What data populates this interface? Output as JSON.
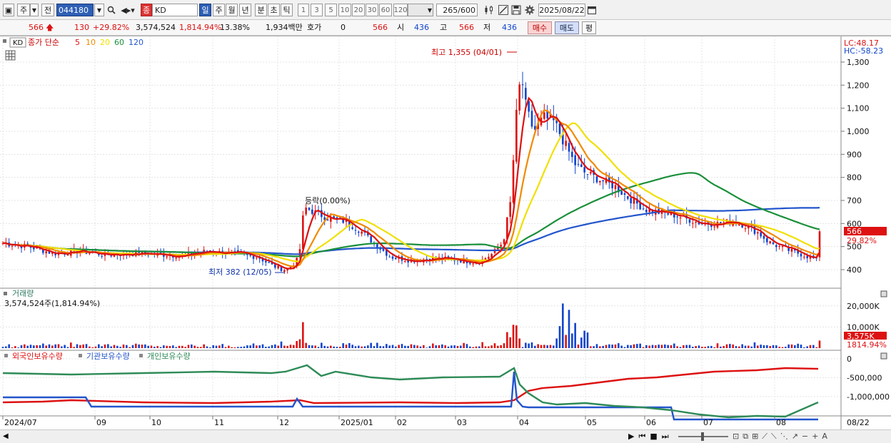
{
  "toolbar": {
    "market_label": "주",
    "prev_label": "전",
    "code": "044180",
    "name_badge": "종",
    "name": "KD",
    "periods": [
      "일",
      "주",
      "월",
      "년",
      "분",
      "초",
      "틱"
    ],
    "active_period": "일",
    "intervals": [
      "1",
      "3",
      "5",
      "10",
      "20",
      "30",
      "60",
      "120"
    ],
    "count": "265",
    "count_max": "/600",
    "date": "2025/08/22"
  },
  "quote": {
    "price": "566",
    "change": "130",
    "change_pct": "+29.82%",
    "volume": "3,574,524",
    "volume_pct": "1,814.94%",
    "turnover_pct": "13.38%",
    "amount": "1,934백만",
    "hoga_label": "호가",
    "hoga": "0",
    "hoga_price": "566",
    "open_label": "시",
    "open": "436",
    "high_label": "고",
    "high": "566",
    "low_label": "저",
    "low": "436",
    "buy_label": "매수",
    "sell_label": "매도",
    "eval_label": "평"
  },
  "chart": {
    "code_tag": "KD",
    "ma_title": "종가 단순",
    "ma_periods": [
      "5",
      "10",
      "20",
      "60",
      "120"
    ],
    "ma_colors": [
      "#dd1111",
      "#f08a00",
      "#f0e000",
      "#1a8f3a",
      "#2255cc"
    ],
    "lc_label": "LC:48.17",
    "hc_label": "HC:-58.23",
    "price_ticks": [
      "1,300",
      "1,200",
      "1,100",
      "1,000",
      "900",
      "800",
      "700",
      "600",
      "500",
      "400"
    ],
    "price_tick_values": [
      1300,
      1200,
      1100,
      1000,
      900,
      800,
      700,
      600,
      500,
      400
    ],
    "high_annot": "최고 1,355 (04/01)",
    "low_annot": "최저 382 (12/05)",
    "drop_annot": "등락(0.00%)",
    "last_price_tag": "566",
    "last_pct_tag": "29.82%",
    "volume_title": "거래량",
    "volume_value": "3,574,524주(1,814.94%)",
    "volume_ticks": [
      "20,000K",
      "10,000K"
    ],
    "volume_tick_values": [
      20000,
      10000
    ],
    "volume_tag": "3,575K",
    "volume_pct_tag": "1814.94%",
    "holding_titles": [
      "외국인보유수량",
      "기관보유수량",
      "개인보유수량"
    ],
    "holding_colors": [
      "#dd1111",
      "#2255cc",
      "#2e8b57"
    ],
    "holding_ticks": [
      "0",
      "-500,000",
      "-1,000,000"
    ],
    "holding_tick_values": [
      0,
      -500000,
      -1000000
    ],
    "x_labels": [
      "2024/07",
      "09",
      "10",
      "11",
      "12",
      "2025/01",
      "02",
      "03",
      "04",
      "05",
      "06",
      "07",
      "08"
    ],
    "x_label_end": "08/22"
  }
}
